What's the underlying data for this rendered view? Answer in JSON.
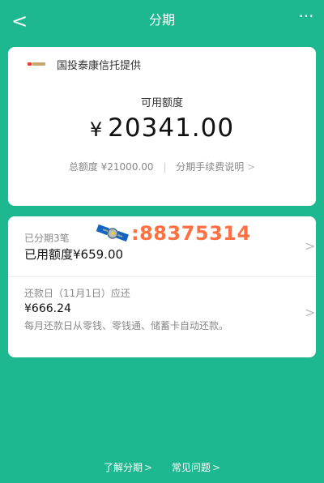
{
  "nav": {
    "back_glyph": "<",
    "title": "分期",
    "more_glyph": "···"
  },
  "summary": {
    "provider_text": "国投泰康信托提供",
    "available_label": "可用额度",
    "available_currency": "¥",
    "available_value": "20341.00",
    "total_limit": "总额度 ¥21000.00",
    "fee_link": "分期手续费说明",
    "chevron": ">"
  },
  "installments": {
    "count_label": "已分期3笔",
    "used_text": "已用额度¥659.00",
    "chevron": ">"
  },
  "overlay": {
    "text": ":88375314",
    "icon": "satellite-icon"
  },
  "repayment": {
    "due_label": "还款日（11月1日）应还",
    "due_amount": "¥666.24",
    "note": "每月还款日从零钱、零钱通、储蓄卡自动还款。",
    "chevron": ">"
  },
  "footer": {
    "learn_link": "了解分期",
    "faq_link": "常见问题",
    "chevron": ">"
  },
  "colors": {
    "background": "#1eb890",
    "card": "#ffffff",
    "overlay_text": "#ff7043"
  }
}
